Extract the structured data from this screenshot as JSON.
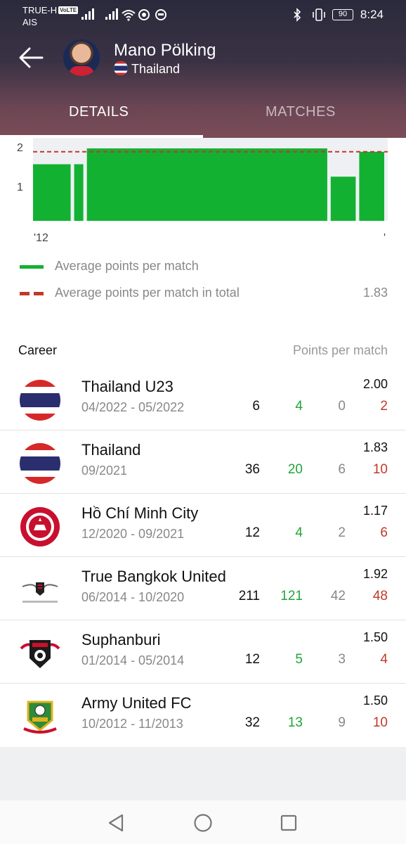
{
  "status_bar": {
    "carrier_line1": "TRUE-H",
    "volte": "VoLTE",
    "carrier_line2": "AIS",
    "battery": "90",
    "time": "8:24"
  },
  "header": {
    "coach_name": "Mano Pölking",
    "country": "Thailand",
    "icons": [
      "back-arrow-icon",
      "thailand-flag-icon"
    ]
  },
  "tabs": [
    {
      "label": "DETAILS",
      "active": true
    },
    {
      "label": "MATCHES",
      "active": false
    }
  ],
  "chart_data": {
    "type": "bar",
    "y_ticks": [
      "2",
      "1"
    ],
    "x_tick_start": "'12",
    "x_tick_end": "'",
    "series": [
      {
        "name": "Average points per match",
        "color": "#13b132",
        "segments": [
          {
            "value": 1.5,
            "span": 13
          },
          {
            "value": 1.5,
            "span": 4
          },
          {
            "value": 1.92,
            "span": 77
          },
          {
            "value": 1.17,
            "span": 9
          },
          {
            "value": 1.83,
            "span": 9
          }
        ]
      },
      {
        "name": "Average points per match in total",
        "color": "#c0392b",
        "value": 1.83,
        "style": "dashed"
      }
    ],
    "ylim": [
      0,
      2.2
    ]
  },
  "legend": [
    {
      "label": "Average points per match",
      "value": "",
      "color": "#13b132",
      "style": "solid"
    },
    {
      "label": "Average points per match in total",
      "value": "1.83",
      "color": "#c0392b",
      "style": "dashed"
    }
  ],
  "career": {
    "heading": "Career",
    "column_label": "Points per match",
    "rows": [
      {
        "team": "Thailand U23",
        "period": "04/2022 - 05/2022",
        "ppm": "2.00",
        "matches": "6",
        "wins": "4",
        "draws": "0",
        "losses": "2",
        "logo": "thailand-flag-icon"
      },
      {
        "team": "Thailand",
        "period": "09/2021",
        "ppm": "1.83",
        "matches": "36",
        "wins": "20",
        "draws": "6",
        "losses": "10",
        "logo": "thailand-flag-icon"
      },
      {
        "team": "Hồ Chí Minh City",
        "period": "12/2020 - 09/2021",
        "ppm": "1.17",
        "matches": "12",
        "wins": "4",
        "draws": "2",
        "losses": "6",
        "logo": "ho-chi-minh-city-crest-icon"
      },
      {
        "team": "True Bangkok United",
        "period": "06/2014 - 10/2020",
        "ppm": "1.92",
        "matches": "211",
        "wins": "121",
        "draws": "42",
        "losses": "48",
        "logo": "bangkok-united-crest-icon"
      },
      {
        "team": "Suphanburi",
        "period": "01/2014 - 05/2014",
        "ppm": "1.50",
        "matches": "12",
        "wins": "5",
        "draws": "3",
        "losses": "4",
        "logo": "suphanburi-crest-icon"
      },
      {
        "team": "Army United FC",
        "period": "10/2012 - 11/2013",
        "ppm": "1.50",
        "matches": "32",
        "wins": "13",
        "draws": "9",
        "losses": "10",
        "logo": "army-united-crest-icon"
      }
    ]
  },
  "nav": [
    "back-triangle-icon",
    "home-circle-icon",
    "recents-square-icon"
  ]
}
